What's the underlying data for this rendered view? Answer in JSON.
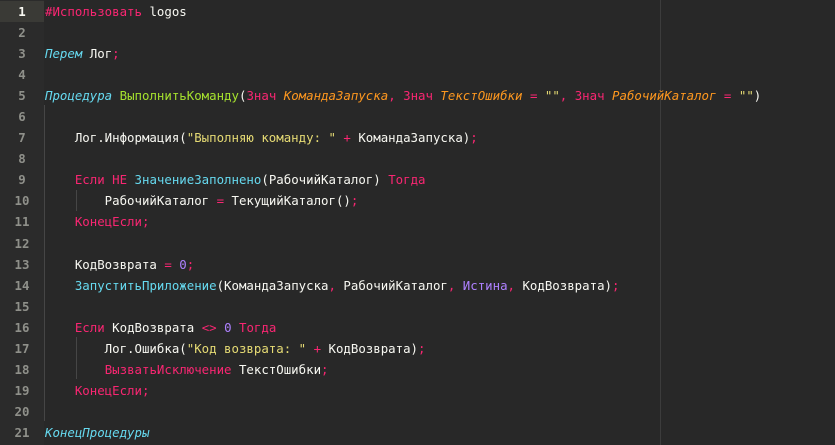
{
  "editor": {
    "current_line": 1,
    "lines": [
      [
        [
          "#Использовать ",
          "kw"
        ],
        [
          "logos",
          "pl"
        ]
      ],
      [],
      [
        [
          "Перем",
          "st"
        ],
        [
          " Лог",
          "pl"
        ],
        [
          ";",
          "op"
        ]
      ],
      [],
      [
        [
          "Процедура",
          "st"
        ],
        [
          " ",
          "pl"
        ],
        [
          "ВыполнитьКоманду",
          "fn"
        ],
        [
          "(",
          "pl"
        ],
        [
          "Знач ",
          "kw"
        ],
        [
          "КомандаЗапуска",
          "pa"
        ],
        [
          ", ",
          "op"
        ],
        [
          "Знач ",
          "kw"
        ],
        [
          "ТекстОшибки",
          "pa"
        ],
        [
          " = ",
          "op"
        ],
        [
          "\"\"",
          "str"
        ],
        [
          ", ",
          "op"
        ],
        [
          "Знач ",
          "kw"
        ],
        [
          "РабочийКаталог",
          "pa"
        ],
        [
          " = ",
          "op"
        ],
        [
          "\"\"",
          "str"
        ],
        [
          ")",
          "pl"
        ]
      ],
      [],
      [
        [
          "    Лог.Информация(",
          "pl"
        ],
        [
          "\"Выполняю команду: \"",
          "str"
        ],
        [
          " + ",
          "op"
        ],
        [
          "КомандаЗапуска)",
          "pl"
        ],
        [
          ";",
          "op"
        ]
      ],
      [],
      [
        [
          "    ",
          "pl"
        ],
        [
          "Если НЕ ",
          "kw"
        ],
        [
          "ЗначениеЗаполнено",
          "bi"
        ],
        [
          "(РабочийКаталог) ",
          "pl"
        ],
        [
          "Тогда",
          "kw"
        ]
      ],
      [
        [
          "        РабочийКаталог",
          "pl"
        ],
        [
          " = ",
          "op"
        ],
        [
          "ТекущийКаталог()",
          "pl"
        ],
        [
          ";",
          "op"
        ]
      ],
      [
        [
          "    ",
          "pl"
        ],
        [
          "КонецЕсли;",
          "kw"
        ]
      ],
      [],
      [
        [
          "    КодВозврата",
          "pl"
        ],
        [
          " = ",
          "op"
        ],
        [
          "0",
          "num"
        ],
        [
          ";",
          "op"
        ]
      ],
      [
        [
          "    ",
          "pl"
        ],
        [
          "ЗапуститьПриложение",
          "bi"
        ],
        [
          "(КомандаЗапуска",
          "pl"
        ],
        [
          ", ",
          "op"
        ],
        [
          "РабочийКаталог",
          "pl"
        ],
        [
          ", ",
          "op"
        ],
        [
          "Истина",
          "num"
        ],
        [
          ", ",
          "op"
        ],
        [
          "КодВозврата)",
          "pl"
        ],
        [
          ";",
          "op"
        ]
      ],
      [],
      [
        [
          "    ",
          "pl"
        ],
        [
          "Если ",
          "kw"
        ],
        [
          "КодВозврата ",
          "pl"
        ],
        [
          "<> ",
          "op"
        ],
        [
          "0 ",
          "num"
        ],
        [
          "Тогда",
          "kw"
        ]
      ],
      [
        [
          "        Лог.Ошибка(",
          "pl"
        ],
        [
          "\"Код возврата: \"",
          "str"
        ],
        [
          " + ",
          "op"
        ],
        [
          "КодВозврата)",
          "pl"
        ],
        [
          ";",
          "op"
        ]
      ],
      [
        [
          "        ",
          "pl"
        ],
        [
          "ВызватьИсключение ",
          "kw"
        ],
        [
          "ТекстОшибки",
          "pl"
        ],
        [
          ";",
          "op"
        ]
      ],
      [
        [
          "    ",
          "pl"
        ],
        [
          "КонецЕсли;",
          "kw"
        ]
      ],
      [],
      [
        [
          "КонецПроцедуры",
          "st"
        ]
      ]
    ]
  }
}
